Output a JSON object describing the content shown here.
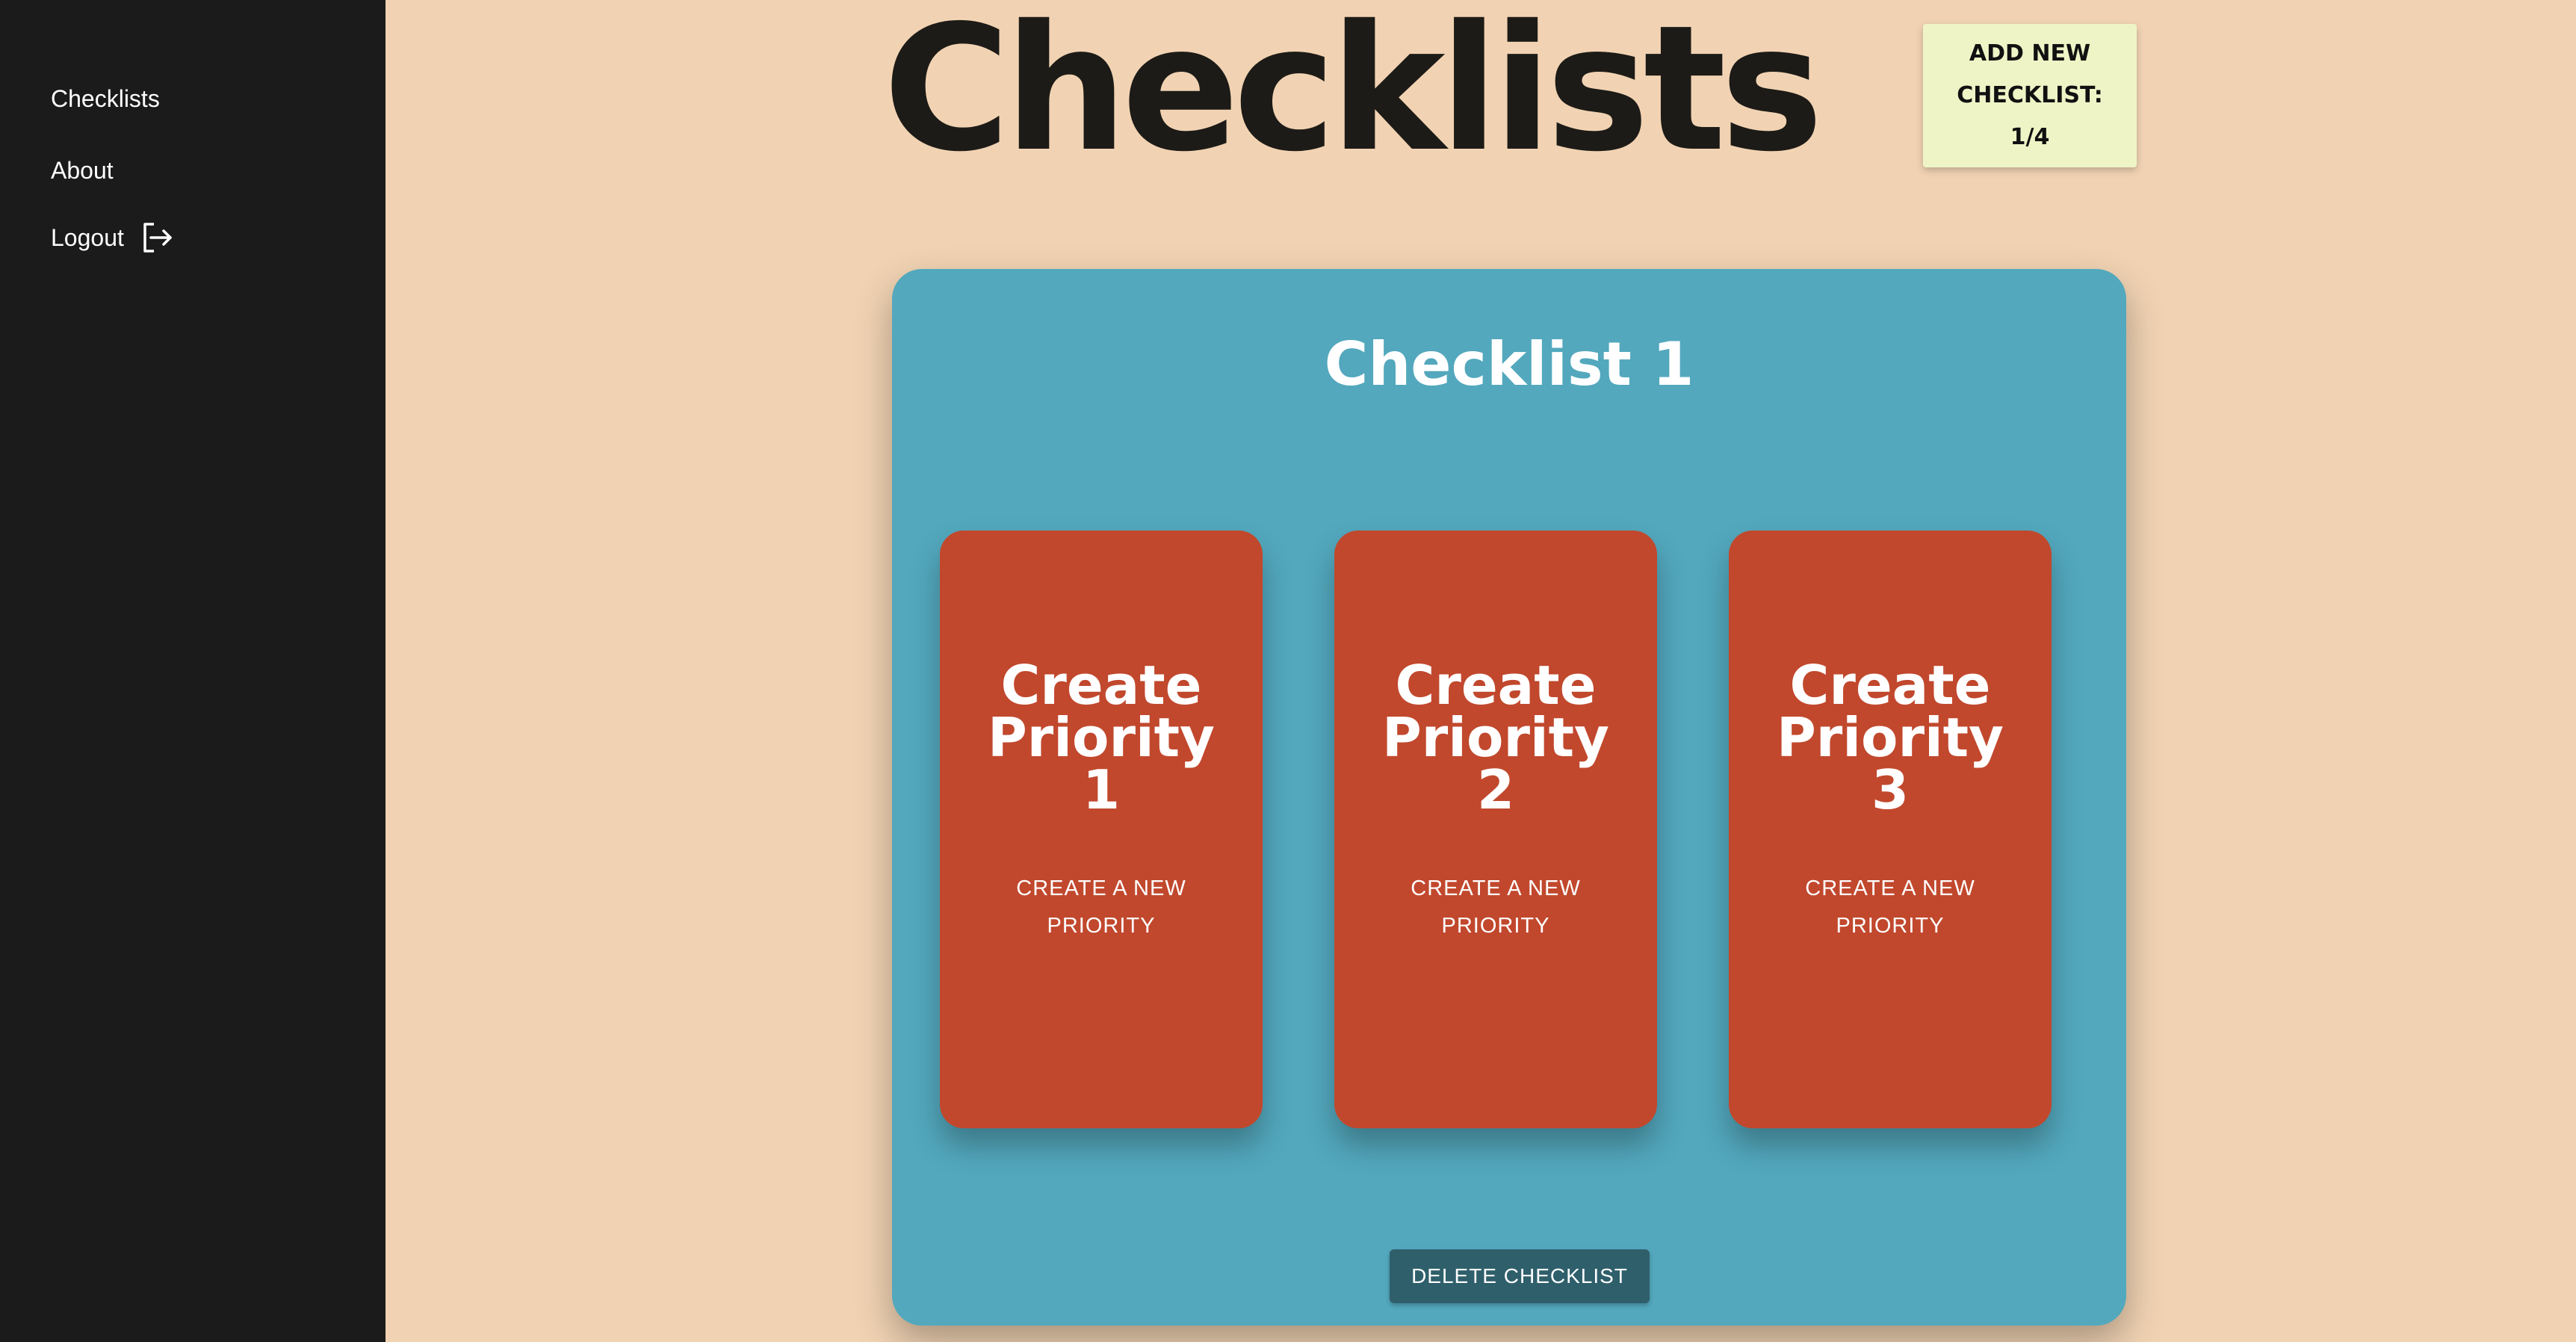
{
  "sidebar": {
    "items": [
      {
        "label": "Checklists",
        "icon": null
      },
      {
        "label": "About",
        "icon": null
      },
      {
        "label": "Logout",
        "icon": "logout-icon"
      }
    ]
  },
  "header": {
    "title": "Checklists",
    "add_button": {
      "line1": "ADD NEW",
      "line2": "CHECKLIST:",
      "line3": "1/4"
    }
  },
  "checklist": {
    "title": "Checklist 1",
    "priorities": [
      {
        "line1": "Create",
        "line2": "Priority",
        "line3": "1",
        "sub1": "CREATE A NEW",
        "sub2": "PRIORITY"
      },
      {
        "line1": "Create",
        "line2": "Priority",
        "line3": "2",
        "sub1": "CREATE A NEW",
        "sub2": "PRIORITY"
      },
      {
        "line1": "Create",
        "line2": "Priority",
        "line3": "3",
        "sub1": "CREATE A NEW",
        "sub2": "PRIORITY"
      }
    ],
    "delete_label": "DELETE CHECKLIST"
  },
  "colors": {
    "background": "#f1d3b3",
    "sidebar": "#1b1b1b",
    "checklist_card": "#53a8bd",
    "priority_card": "#c1482d",
    "add_button": "#eef4c6",
    "delete_button": "#2f5f6b"
  }
}
